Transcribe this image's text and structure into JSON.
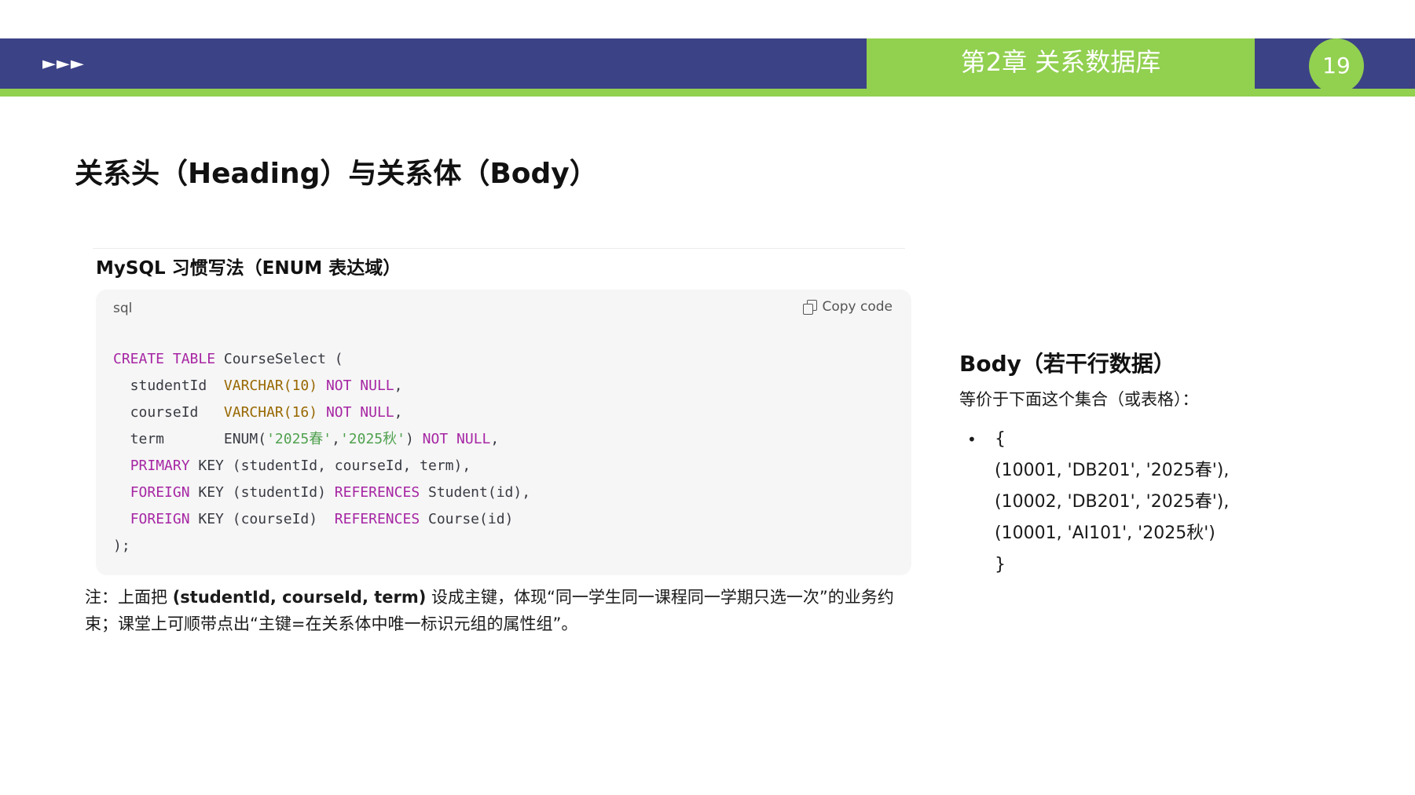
{
  "header": {
    "arrows": "►►►",
    "chapter_title": "第2章   关系数据库",
    "page_number": "19",
    "colors": {
      "band": "#3c4286",
      "accent": "#92d050"
    }
  },
  "slide_title": "关系头（Heading）与关系体（Body）",
  "code_section": {
    "heading": "MySQL 习惯写法（ENUM 表达域）",
    "language": "sql",
    "copy_label": "Copy code",
    "lines": [
      [
        {
          "t": "CREATE TABLE",
          "c": "kw"
        },
        {
          "t": " CourseSelect (",
          "c": ""
        }
      ],
      [
        {
          "t": "  studentId  ",
          "c": ""
        },
        {
          "t": "VARCHAR(10)",
          "c": "ty"
        },
        {
          "t": " ",
          "c": ""
        },
        {
          "t": "NOT NULL",
          "c": "kw"
        },
        {
          "t": ",",
          "c": ""
        }
      ],
      [
        {
          "t": "  courseId   ",
          "c": ""
        },
        {
          "t": "VARCHAR(16)",
          "c": "ty"
        },
        {
          "t": " ",
          "c": ""
        },
        {
          "t": "NOT NULL",
          "c": "kw"
        },
        {
          "t": ",",
          "c": ""
        }
      ],
      [
        {
          "t": "  term       ENUM(",
          "c": ""
        },
        {
          "t": "'2025春'",
          "c": "st"
        },
        {
          "t": ",",
          "c": ""
        },
        {
          "t": "'2025秋'",
          "c": "st"
        },
        {
          "t": ") ",
          "c": ""
        },
        {
          "t": "NOT NULL",
          "c": "kw"
        },
        {
          "t": ",",
          "c": ""
        }
      ],
      [
        {
          "t": "  ",
          "c": ""
        },
        {
          "t": "PRIMARY",
          "c": "kw"
        },
        {
          "t": " KEY (studentId, courseId, term),",
          "c": ""
        }
      ],
      [
        {
          "t": "  ",
          "c": ""
        },
        {
          "t": "FOREIGN",
          "c": "kw"
        },
        {
          "t": " KEY (studentId) ",
          "c": ""
        },
        {
          "t": "REFERENCES",
          "c": "kw"
        },
        {
          "t": " Student(id),",
          "c": ""
        }
      ],
      [
        {
          "t": "  ",
          "c": ""
        },
        {
          "t": "FOREIGN",
          "c": "kw"
        },
        {
          "t": " KEY (courseId)  ",
          "c": ""
        },
        {
          "t": "REFERENCES",
          "c": "kw"
        },
        {
          "t": " Course(id)",
          "c": ""
        }
      ],
      [
        {
          "t": ");",
          "c": ""
        }
      ]
    ]
  },
  "note": {
    "prefix": "注：上面把 ",
    "bold": "(studentId, courseId, term)",
    "suffix": " 设成主键，体现“同一学生同一课程同一学期只选一次”的业务约束；课堂上可顺带点出“主键=在关系体中唯一标识元组的属性组”。"
  },
  "body_panel": {
    "title": "Body（若干行数据）",
    "description": "等价于下面这个集合（或表格）：",
    "bullet": "•",
    "set_lines": [
      "{",
      "(10001, 'DB201', '2025春'),",
      "(10002, 'DB201', '2025春'),",
      "(10001, 'AI101', '2025秋')",
      "}"
    ]
  }
}
